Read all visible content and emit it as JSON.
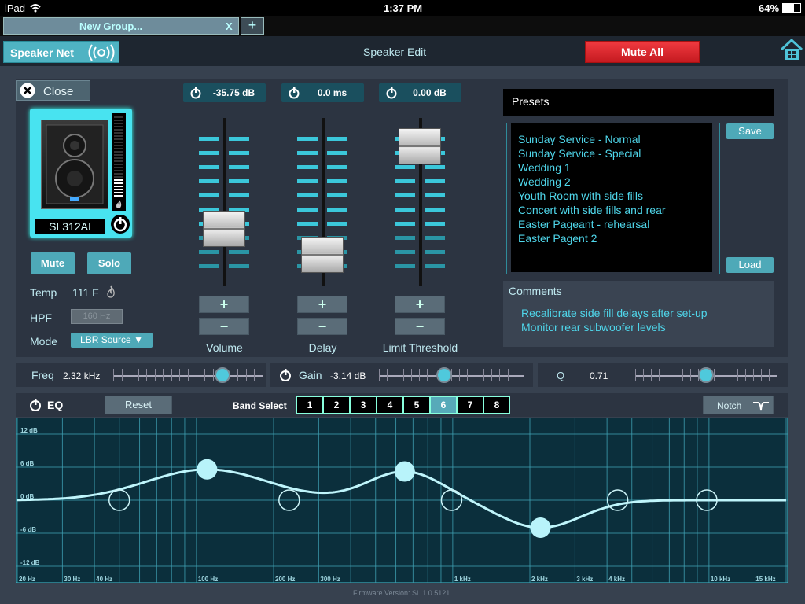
{
  "status": {
    "device": "iPad",
    "time": "1:37 PM",
    "battery": "64%"
  },
  "tabs": [
    {
      "label": "New Group...",
      "close": "X"
    }
  ],
  "add_tab": "+",
  "header": {
    "net_label": "Speaker Net",
    "title": "Speaker Edit",
    "mute_all": "Mute All"
  },
  "close_label": "Close",
  "speaker": {
    "model": "SL312AI"
  },
  "mute_label": "Mute",
  "solo_label": "Solo",
  "info": {
    "temp_label": "Temp",
    "temp_value": "111 F",
    "hpf_label": "HPF",
    "hpf_value": "160 Hz",
    "mode_label": "Mode",
    "mode_value": "LBR Source ▼"
  },
  "faders": [
    {
      "readout": "-35.75 dB",
      "label": "Volume",
      "level": 0.3
    },
    {
      "readout": "0.0 ms",
      "label": "Delay",
      "level": 0.1
    },
    {
      "readout": "0.00 dB",
      "label": "Limit Threshold",
      "level": 0.92
    }
  ],
  "presets": {
    "title": "Presets",
    "items": [
      "Sunday Service - Normal",
      "Sunday Service - Special",
      "Wedding 1",
      "Wedding 2",
      "Youth Room with side fills",
      "Concert with side fills and rear",
      "Easter Pageant - rehearsal",
      "Easter Pagent 2"
    ],
    "save_label": "Save",
    "load_label": "Load"
  },
  "comments": {
    "title": "Comments",
    "lines": [
      "Recalibrate side fill delays after set-up",
      "Monitor rear subwoofer levels"
    ]
  },
  "params": {
    "freq_label": "Freq",
    "freq_value": "2.32 kHz",
    "gain_label": "Gain",
    "gain_value": "-3.14 dB",
    "q_label": "Q",
    "q_value": "0.71"
  },
  "eq": {
    "label": "EQ",
    "reset_label": "Reset",
    "band_select_label": "Band Select",
    "bands": [
      "1",
      "2",
      "3",
      "4",
      "5",
      "6",
      "7",
      "8"
    ],
    "selected_band": "6",
    "filter_type": "Notch",
    "y_labels": [
      "12 dB",
      "6 dB",
      "0 dB",
      "-6 dB",
      "-12 dB"
    ],
    "x_labels": [
      "20 Hz",
      "30 Hz",
      "40 Hz",
      "100 Hz",
      "200 Hz",
      "300 Hz",
      "1 kHz",
      "2 kHz",
      "3 kHz",
      "4 kHz",
      "10 kHz",
      "15 kHz"
    ]
  },
  "firmware": "Firmware Version:   SL 1.0.5121",
  "colors": {
    "accent": "#4fb3c3",
    "mute_red": "#d91f26",
    "panel": "#2c3441"
  }
}
